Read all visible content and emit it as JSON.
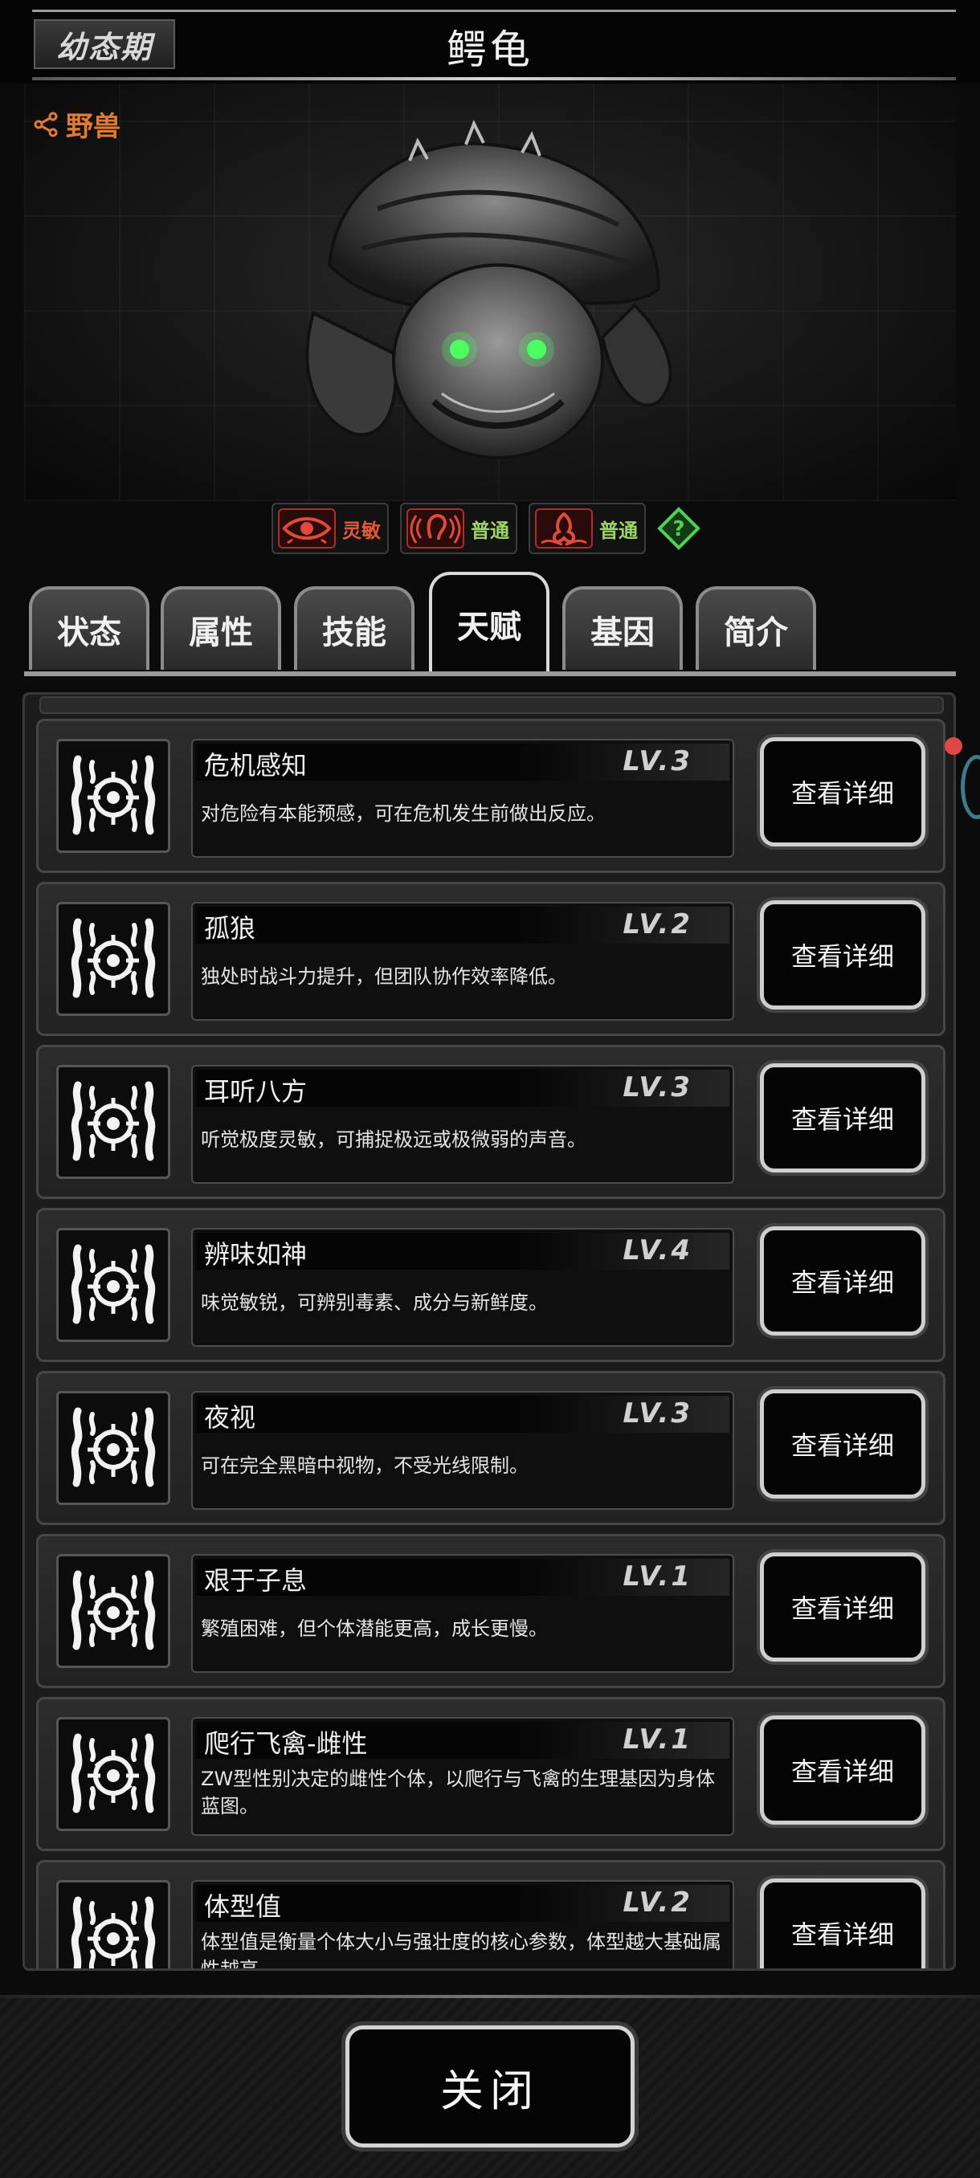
{
  "header": {
    "stage": "幼态期",
    "name": "鳄龟"
  },
  "portrait": {
    "share_label": "野兽"
  },
  "senses": [
    {
      "icon": "eye-icon",
      "label": "灵敏",
      "color": "#e05a3a"
    },
    {
      "icon": "ear-icon",
      "label": "普通",
      "color": "#9ed36a"
    },
    {
      "icon": "smell-icon",
      "label": "普通",
      "color": "#9ed36a"
    }
  ],
  "tabs": [
    {
      "label": "状态"
    },
    {
      "label": "属性"
    },
    {
      "label": "技能"
    },
    {
      "label": "天赋"
    },
    {
      "label": "基因"
    },
    {
      "label": "简介"
    }
  ],
  "active_tab": "天赋",
  "talents": [
    {
      "name": "危机感知",
      "level": "LV.3",
      "desc": "对危险有本能预感，可在危机发生前做出反应。",
      "button": "查看详细"
    },
    {
      "name": "孤狼",
      "level": "LV.2",
      "desc": "独处时战斗力提升，但团队协作效率降低。",
      "button": "查看详细"
    },
    {
      "name": "耳听八方",
      "level": "LV.3",
      "desc": "听觉极度灵敏，可捕捉极远或极微弱的声音。",
      "button": "查看详细"
    },
    {
      "name": "辨味如神",
      "level": "LV.4",
      "desc": "味觉敏锐，可辨别毒素、成分与新鲜度。",
      "button": "查看详细"
    },
    {
      "name": "夜视",
      "level": "LV.3",
      "desc": "可在完全黑暗中视物，不受光线限制。",
      "button": "查看详细"
    },
    {
      "name": "艰于子息",
      "level": "LV.1",
      "desc": "繁殖困难，但个体潜能更高，成长更慢。",
      "button": "查看详细"
    },
    {
      "name": "爬行飞禽-雌性",
      "level": "LV.1",
      "desc": "ZW型性别决定的雌性个体，以爬行与飞禽的生理基因为身体蓝图。",
      "button": "查看详细"
    },
    {
      "name": "体型值",
      "level": "LV.2",
      "desc": "体型值是衡量个体大小与强壮度的核心参数，体型越大基础属性越高。",
      "button": "查看详细"
    }
  ],
  "footer": {
    "close_label": "关闭"
  }
}
